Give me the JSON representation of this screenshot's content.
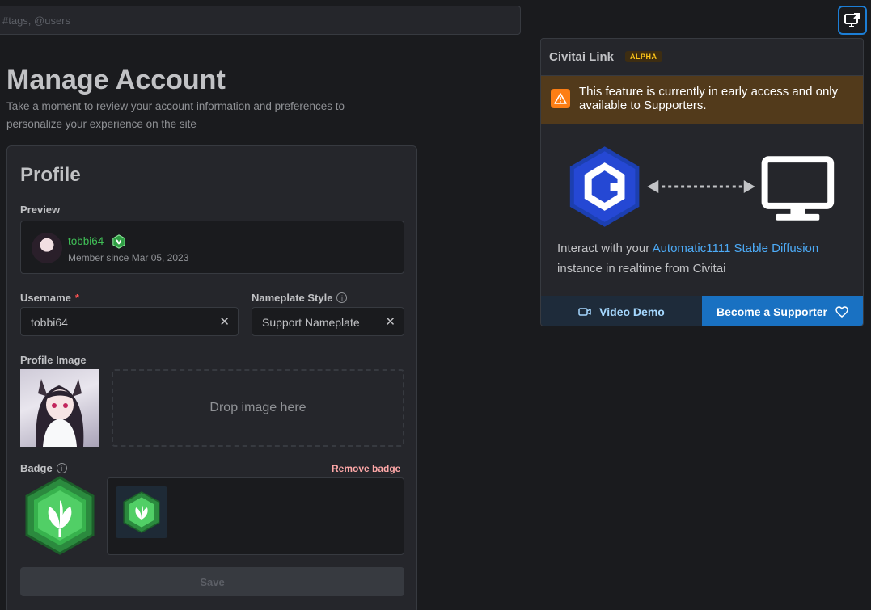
{
  "header": {
    "search_placeholder": "#tags, @users"
  },
  "page": {
    "title": "Manage Account",
    "description": "Take a moment to review your account information and preferences to personalize your experience on the site"
  },
  "profile": {
    "title": "Profile",
    "preview_label": "Preview",
    "preview_username": "tobbi64",
    "member_since": "Member since Mar 05, 2023",
    "username_label": "Username",
    "required_mark": "*",
    "username_value": "tobbi64",
    "nameplate_label": "Nameplate Style",
    "nameplate_value": "Support Nameplate",
    "profile_image_label": "Profile Image",
    "dropzone_text": "Drop image here",
    "badge_label": "Badge",
    "remove_badge_label": "Remove badge",
    "save_label": "Save",
    "info_glyph": "i",
    "clear_glyph": "✕"
  },
  "link_popover": {
    "title": "Civitai Link",
    "badge": "ALPHA",
    "warning": "This feature is currently in early access and only available to Supporters.",
    "desc_prefix": "Interact with your ",
    "desc_link": "Automatic1111 Stable Diffusion",
    "desc_suffix": " instance in realtime from Civitai",
    "video_demo_label": "Video Demo",
    "supporter_label": "Become a Supporter"
  },
  "colors": {
    "accent": "#1c7ed6",
    "brand_green": "#40c057",
    "warning_bg": "#523a1b",
    "supporter_blue": "#1971c2"
  },
  "icons": [
    "screen-share-icon",
    "warning-icon",
    "civitai-logo-icon",
    "monitor-icon",
    "video-icon",
    "heart-icon",
    "info-icon",
    "clear-icon",
    "leaf-badge-icon"
  ]
}
